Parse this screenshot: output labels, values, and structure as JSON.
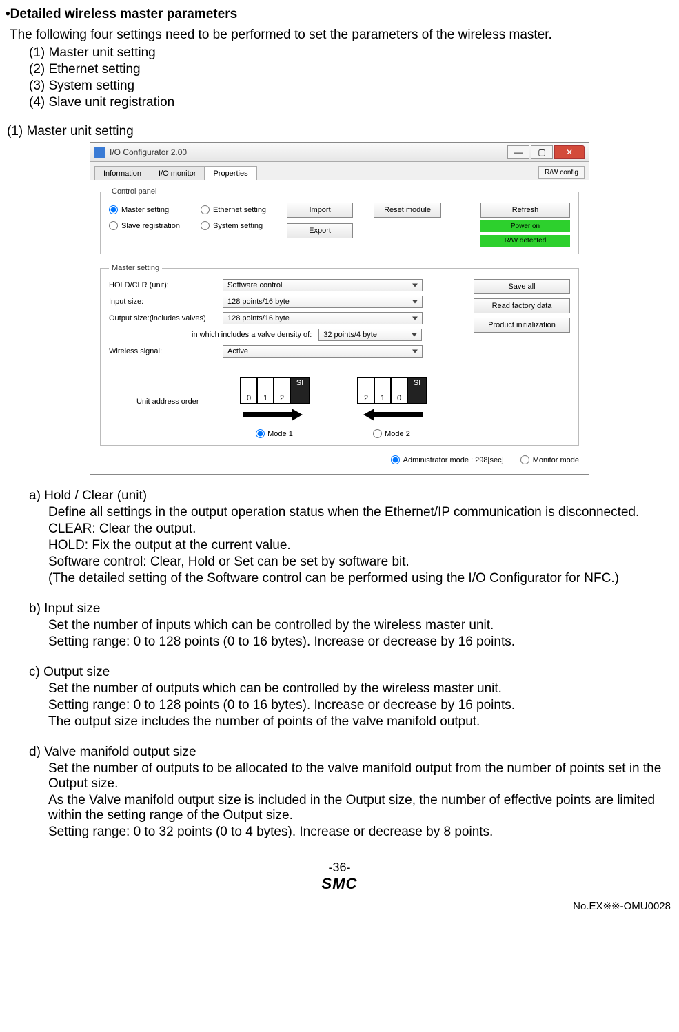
{
  "heading": "•Detailed wireless master parameters",
  "intro": "The following four settings need to be performed to set the parameters of the wireless master.",
  "settings_list": [
    "(1) Master unit setting",
    "(2) Ethernet setting",
    "(3) System setting",
    "(4) Slave unit registration"
  ],
  "section_title": "(1) Master unit setting",
  "app": {
    "title": "I/O Configurator 2.00",
    "tabs": {
      "info": "Information",
      "io": "I/O monitor",
      "prop": "Properties"
    },
    "rw_btn": "R/W config",
    "control_panel": {
      "legend": "Control panel",
      "master_setting": "Master setting",
      "ethernet_setting": "Ethernet setting",
      "slave_registration": "Slave registration",
      "system_setting": "System setting",
      "import": "Import",
      "export": "Export",
      "reset": "Reset module",
      "refresh": "Refresh",
      "power_on": "Power on",
      "rw_detected": "R/W detected"
    },
    "master_setting": {
      "legend": "Master setting",
      "hold_label": "HOLD/CLR (unit):",
      "hold_value": "Software control",
      "input_label": "Input size:",
      "input_value": "128 points/16 byte",
      "output_label": "Output size:(includes valves)",
      "output_value": "128 points/16 byte",
      "valve_label": "in which includes a valve density of:",
      "valve_value": "32 points/4 byte",
      "wireless_label": "Wireless signal:",
      "wireless_value": "Active",
      "save_all": "Save all",
      "read_factory": "Read factory data",
      "prod_init": "Product initialization",
      "addr_label": "Unit address order",
      "mode1": "Mode 1",
      "mode2": "Mode 2",
      "box012": [
        "0",
        "1",
        "2"
      ],
      "box210": [
        "2",
        "1",
        "0"
      ],
      "si": "SI"
    },
    "footer": {
      "admin": "Administrator mode : 298[sec]",
      "monitor": "Monitor mode"
    }
  },
  "explain": {
    "a": {
      "title": "a) Hold / Clear (unit)",
      "lines": [
        "Define all settings in the output operation status when the Ethernet/IP communication is disconnected.",
        "CLEAR: Clear the output.",
        "HOLD: Fix the output at the current value.",
        "Software control: Clear, Hold or Set can be set by software bit.",
        "(The detailed setting of the Software control can be performed using the I/O Configurator for NFC.)"
      ]
    },
    "b": {
      "title": "b) Input size",
      "lines": [
        "Set the number of inputs which can be controlled by the wireless master unit.",
        "Setting range: 0 to 128 points (0 to 16 bytes). Increase or decrease by 16 points."
      ]
    },
    "c": {
      "title": "c) Output size",
      "lines": [
        "Set the number of outputs which can be controlled by the wireless master unit.",
        "Setting range: 0 to 128 points (0 to 16 bytes). Increase or decrease by 16 points.",
        "The output size includes the number of points of the valve manifold output."
      ]
    },
    "d": {
      "title": "d) Valve manifold output size",
      "lines": [
        "Set the number of outputs to be allocated to the valve manifold output from the number of points set in the Output size.",
        "As the Valve manifold output size is included in the Output size, the number of effective points are limited within the setting range of the Output size.",
        "Setting range: 0 to 32 points (0 to 4 bytes). Increase or decrease by 8 points."
      ]
    }
  },
  "footer": {
    "page": "-36-",
    "logo": "SMC",
    "docno": "No.EX※※-OMU0028"
  }
}
